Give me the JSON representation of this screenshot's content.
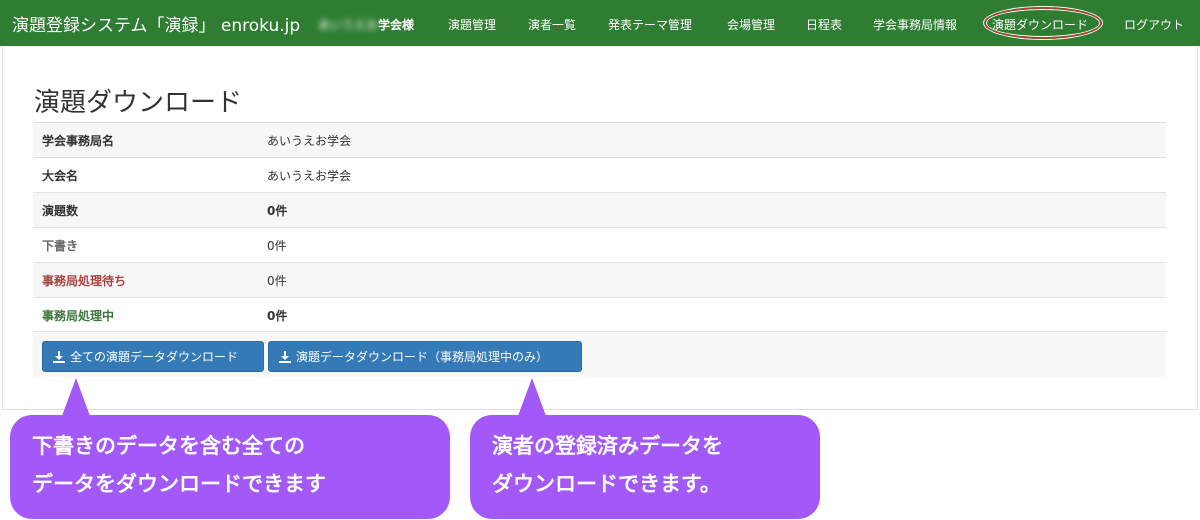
{
  "navbar": {
    "brand": "演題登録システム「演録」 enroku.jp",
    "user_blurred": "あいうえお",
    "user_suffix": "学会様",
    "items": [
      {
        "label": "演題管理"
      },
      {
        "label": "演者一覧"
      },
      {
        "label": "発表テーマ管理"
      },
      {
        "label": "会場管理"
      },
      {
        "label": "日程表"
      },
      {
        "label": "学会事務局情報"
      },
      {
        "label": "演題ダウンロード"
      },
      {
        "label": "ログアウト"
      }
    ],
    "highlight_color": "#d32f2f",
    "bg_color": "#2f7d32"
  },
  "page": {
    "title": "演題ダウンロード"
  },
  "info": {
    "rows": [
      {
        "label": "学会事務局名",
        "value": "あいうえお学会"
      },
      {
        "label": "大会名",
        "value": "あいうえお学会"
      },
      {
        "label": "演題数",
        "value": "0件"
      },
      {
        "label": "下書き",
        "value": "0件"
      },
      {
        "label": "事務局処理待ち",
        "value": "0件"
      },
      {
        "label": "事務局処理中",
        "value": "0件"
      }
    ]
  },
  "buttons": {
    "download_all": "全ての演題データダウンロード",
    "download_office": "演題データダウンロード（事務局処理中のみ）",
    "icon": "download-icon",
    "color": "#337ab7"
  },
  "callouts": {
    "left_line1": "下書きのデータを含む全ての",
    "left_line2": "データをダウンロードできます",
    "right_line1": "演者の登録済みデータを",
    "right_line2": "ダウンロードできます。",
    "color": "#a259f7"
  }
}
